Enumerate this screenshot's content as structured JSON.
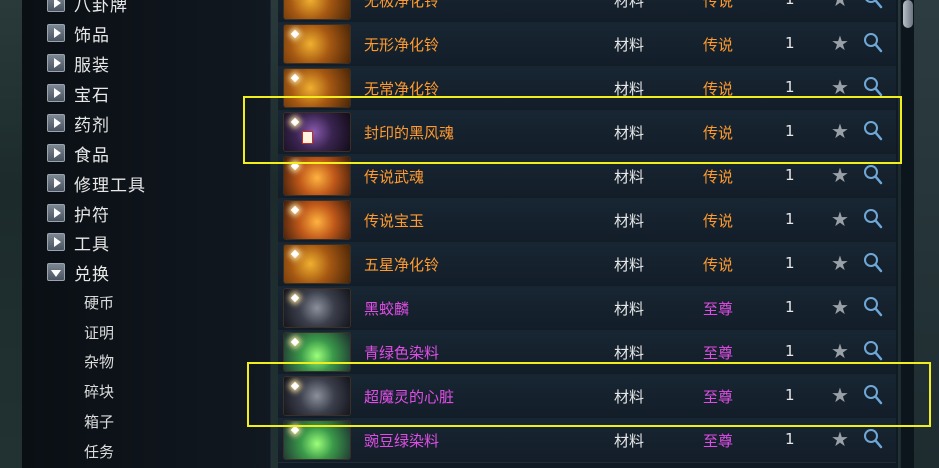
{
  "sidebar": {
    "categories": [
      {
        "label": "八卦牌",
        "open": false
      },
      {
        "label": "饰品",
        "open": false
      },
      {
        "label": "服装",
        "open": false
      },
      {
        "label": "宝石",
        "open": false
      },
      {
        "label": "药剂",
        "open": false
      },
      {
        "label": "食品",
        "open": false
      },
      {
        "label": "修理工具",
        "open": false
      },
      {
        "label": "护符",
        "open": false
      },
      {
        "label": "工具",
        "open": false
      },
      {
        "label": "兑换",
        "open": true
      }
    ],
    "subitems": [
      "硬币",
      "证明",
      "杂物",
      "碎块",
      "箱子",
      "任务"
    ]
  },
  "items": [
    {
      "name": "无极净化铃",
      "type": "材料",
      "grade": "传说",
      "qty": "1",
      "rarity": "legend",
      "thumb": "gold"
    },
    {
      "name": "无形净化铃",
      "type": "材料",
      "grade": "传说",
      "qty": "1",
      "rarity": "legend",
      "thumb": "gold"
    },
    {
      "name": "无常净化铃",
      "type": "材料",
      "grade": "传说",
      "qty": "1",
      "rarity": "legend",
      "thumb": "gold"
    },
    {
      "name": "封印的黑风魂",
      "type": "材料",
      "grade": "传说",
      "qty": "1",
      "rarity": "legend",
      "thumb": "dark",
      "seal": true
    },
    {
      "name": "传说武魂",
      "type": "材料",
      "grade": "传说",
      "qty": "1",
      "rarity": "legend",
      "thumb": "amber"
    },
    {
      "name": "传说宝玉",
      "type": "材料",
      "grade": "传说",
      "qty": "1",
      "rarity": "legend",
      "thumb": "amber"
    },
    {
      "name": "五星净化铃",
      "type": "材料",
      "grade": "传说",
      "qty": "1",
      "rarity": "legend",
      "thumb": "gold"
    },
    {
      "name": "黑蛟麟",
      "type": "材料",
      "grade": "至尊",
      "qty": "1",
      "rarity": "supreme",
      "thumb": "ink"
    },
    {
      "name": "青绿色染料",
      "type": "材料",
      "grade": "至尊",
      "qty": "1",
      "rarity": "supreme",
      "thumb": "green"
    },
    {
      "name": "超魔灵的心脏",
      "type": "材料",
      "grade": "至尊",
      "qty": "1",
      "rarity": "supreme",
      "thumb": "ink"
    },
    {
      "name": "豌豆绿染料",
      "type": "材料",
      "grade": "至尊",
      "qty": "1",
      "rarity": "supreme",
      "thumb": "green"
    }
  ],
  "colors": {
    "legend": "#ff9a2e",
    "supreme": "#e04ee6",
    "highlight": "#f2ee1c"
  },
  "icons": {
    "favorite": "star-icon",
    "inspect": "magnifier-icon"
  }
}
